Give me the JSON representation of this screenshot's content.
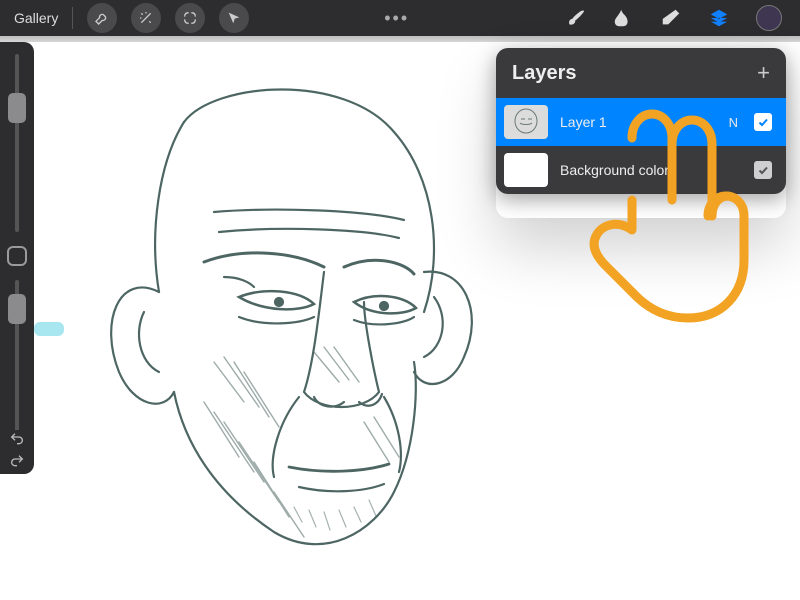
{
  "topbar": {
    "gallery_label": "Gallery",
    "more_dots": "•••"
  },
  "tools_left": [
    {
      "name": "wrench-icon"
    },
    {
      "name": "magic-wand-icon"
    },
    {
      "name": "selection-icon"
    },
    {
      "name": "cursor-arrow-icon"
    }
  ],
  "tools_right": {
    "brush": {
      "name": "brush-icon",
      "active": false
    },
    "smudge": {
      "name": "smudge-icon",
      "active": false
    },
    "eraser": {
      "name": "eraser-icon",
      "active": false
    },
    "layers": {
      "name": "layers-icon",
      "active": true
    },
    "color": {
      "name": "color-swatch",
      "hex": "#3f3752"
    }
  },
  "sidebar": {
    "brush_size_thumb_pos": 0.22,
    "opacity_thumb_pos": 0.18
  },
  "layers_panel": {
    "title": "Layers",
    "add_label": "+",
    "items": [
      {
        "name": "Layer 1",
        "blend_short": "N",
        "visible": true,
        "selected": true
      },
      {
        "name": "Background color",
        "blend_short": "",
        "visible": true,
        "selected": false
      }
    ]
  },
  "colors": {
    "accent": "#0084ff",
    "toolbar": "#2d2d2f",
    "panel": "#3a3a3c",
    "gesture": "#f2a324"
  }
}
